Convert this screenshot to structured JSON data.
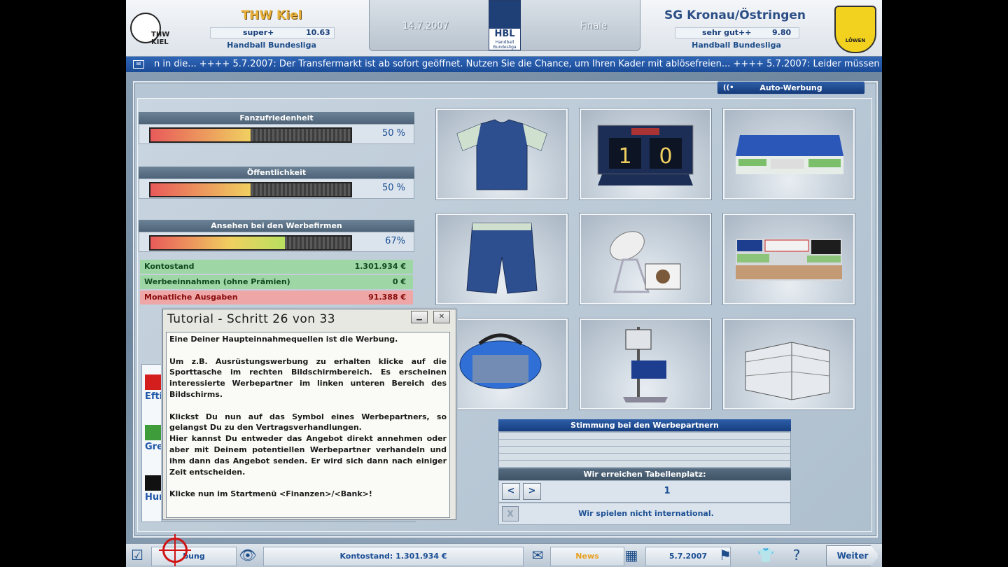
{
  "header": {
    "home": {
      "name": "THW Kiel",
      "rating_label": "super+",
      "rating_value": "10.63",
      "league": "Handball Bundesliga",
      "logo_text": "THW KIEL"
    },
    "away": {
      "name": "SG Kronau/Östringen",
      "rating_label": "sehr gut++",
      "rating_value": "9.80",
      "league": "Handball Bundesliga",
      "logo_text": "LÖWEN"
    },
    "date": "14.7.2007",
    "round": "Finale",
    "hbl_logo": {
      "text": "HBL",
      "sub": "Handball Bundesliga"
    }
  },
  "ticker": {
    "icon": "mail-icon",
    "text": "n in die...    ++++   5.7.2007: Der Transfermarkt ist ab sofort geöffnet. Nutzen Sie die Chance, um Ihren Kader mit ablösefreien...    ++++   5.7.2007: Leider müssen"
  },
  "autowerbung": {
    "label": "Auto-Werbung",
    "icon": "signal-icon"
  },
  "stats": [
    {
      "title": "Fanzufriedenheit",
      "value": 0.5,
      "pct": "50 %"
    },
    {
      "title": "Öffentlichkeit",
      "value": 0.5,
      "pct": "50 %"
    },
    {
      "title": "Ansehen bei den Werbefirmen",
      "value": 0.67,
      "pct": "67%"
    }
  ],
  "money": {
    "konto": {
      "label": "Kontostand",
      "value": "1.301.934 €"
    },
    "werbe": {
      "label": "Werbeeinnahmen (ohne Prämien)",
      "value": "0 €"
    },
    "ausgaben": {
      "label": "Monatliche Ausgaben",
      "value": "91.388 €"
    }
  },
  "sponsors": [
    {
      "name": "Efti",
      "logo": "red-square-logo"
    },
    {
      "name": "Gre",
      "logo": "green-logo"
    },
    {
      "name": "Hur",
      "logo": "black-logo"
    }
  ],
  "thumbnails": [
    {
      "name": "trikot",
      "icon": "shirt-icon"
    },
    {
      "name": "anzeigetafel",
      "icon": "scoreboard-icon",
      "score_home": "1",
      "score_away": "0"
    },
    {
      "name": "tribuene",
      "icon": "stand-icon"
    },
    {
      "name": "hose",
      "icon": "shorts-icon"
    },
    {
      "name": "tv",
      "icon": "satellite-icon"
    },
    {
      "name": "bande",
      "icon": "banner-icon"
    },
    {
      "name": "sporttasche",
      "icon": "bag-icon"
    },
    {
      "name": "kamera",
      "icon": "camera-icon"
    },
    {
      "name": "halle",
      "icon": "arena-icon"
    }
  ],
  "stimmung": {
    "title": "Stimmung bei den Werbepartnern"
  },
  "tabellenplatz": {
    "title": "Wir erreichen Tabellenplatz:",
    "value": "1",
    "prev": "<",
    "next": ">"
  },
  "international": {
    "text": "Wir spielen nicht international.",
    "check": "X"
  },
  "tutorial": {
    "title": "Tutorial - Schritt  26  von  33",
    "minimize": "▁",
    "close": "✕",
    "paragraphs": [
      "Eine Deiner Haupteinnahmequellen ist die Werbung.",
      "Um z.B. Ausrüstungswerbung zu erhalten klicke auf die Sporttasche im rechten Bildschirmbereich. Es erscheinen interessierte Werbepartner im linken unteren Bereich des Bildschirms.",
      "Klickst Du nun auf das Symbol eines Werbepartners, so gelangst Du zu den Vertragsverhandlungen.",
      "Hier kannst Du entweder das Angebot direkt annehmen oder aber mit Deinem potentiellen Werbepartner verhandeln und ihm dann das Angebot senden. Er wird sich dann nach einiger Zeit entscheiden.",
      "Klicke nun im Startmenü <Finanzen>/<Bank>!"
    ]
  },
  "bottombar": {
    "werbung": "bung",
    "konto": "Kontostand: 1.301.934 €",
    "news": "News",
    "date": "5.7.2007",
    "weiter": "Weiter"
  },
  "colors": {
    "accent": "#1f4f9a",
    "fill_start": "#e85a5a",
    "fill_mid": "#f0d060",
    "fill_end": "#b8e060"
  }
}
